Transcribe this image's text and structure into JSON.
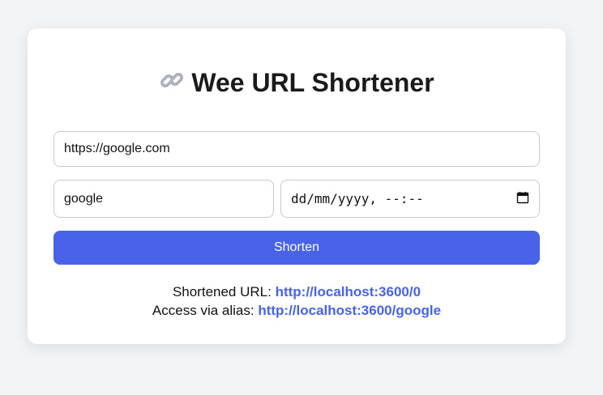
{
  "header": {
    "title": "Wee URL Shortener",
    "icon": "link-icon"
  },
  "form": {
    "url_value": "https://google.com",
    "alias_value": "google",
    "date_value": "dd/mm/yyyy, --:--",
    "date_icon": "calendar-icon",
    "submit_label": "Shorten"
  },
  "result": {
    "short_label": "Shortened URL:",
    "short_url": "http://localhost:3600/0",
    "alias_label": "Access via alias:",
    "alias_url": "http://localhost:3600/google"
  },
  "colors": {
    "accent": "#4863e8",
    "background": "#f3f4f6",
    "card": "#ffffff",
    "text": "#1a1a1a"
  }
}
